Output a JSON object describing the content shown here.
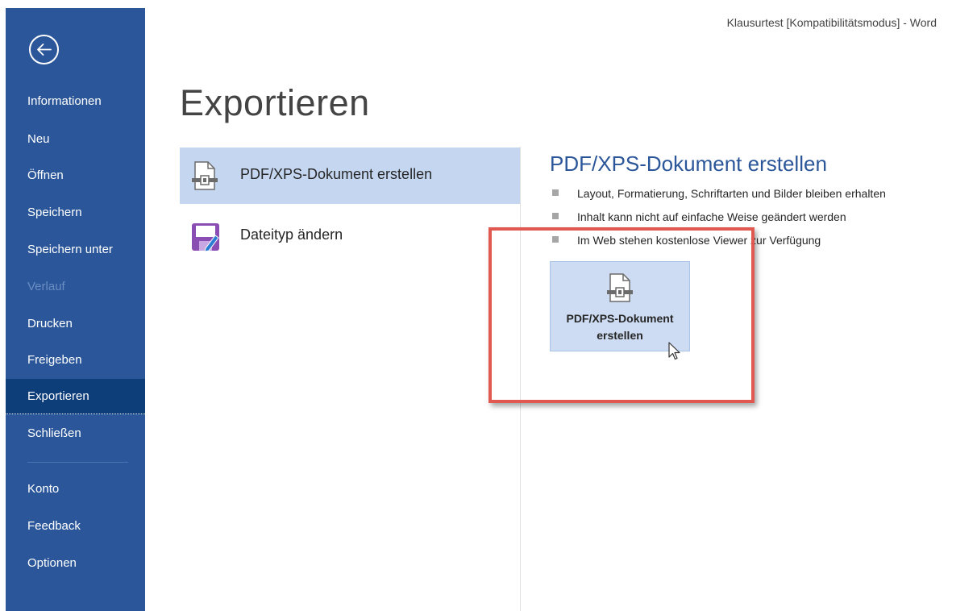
{
  "window": {
    "title": "Klausurtest [Kompatibilitätsmodus]  -  Word"
  },
  "sidebar": {
    "back_icon": "back-arrow-icon",
    "items": [
      {
        "label": "Informationen",
        "enabled": true
      },
      {
        "label": "Neu",
        "enabled": true
      },
      {
        "label": "Öffnen",
        "enabled": true
      },
      {
        "label": "Speichern",
        "enabled": true
      },
      {
        "label": "Speichern unter",
        "enabled": true
      },
      {
        "label": "Verlauf",
        "enabled": false
      },
      {
        "label": "Drucken",
        "enabled": true
      },
      {
        "label": "Freigeben",
        "enabled": true
      },
      {
        "label": "Exportieren",
        "enabled": true,
        "active": true
      },
      {
        "label": "Schließen",
        "enabled": true
      },
      {
        "label": "Konto",
        "enabled": true
      },
      {
        "label": "Feedback",
        "enabled": true
      },
      {
        "label": "Optionen",
        "enabled": true
      }
    ]
  },
  "main": {
    "page_title": "Exportieren",
    "options": [
      {
        "label": "PDF/XPS-Dokument erstellen",
        "icon": "pdf-xps-document-icon",
        "selected": true
      },
      {
        "label": "Dateityp ändern",
        "icon": "save-as-filetype-icon",
        "selected": false
      }
    ],
    "detail": {
      "title": "PDF/XPS-Dokument erstellen",
      "bullets": [
        "Layout, Formatierung, Schriftarten und Bilder bleiben erhalten",
        "Inhalt kann nicht auf einfache Weise geändert werden",
        "Im Web stehen kostenlose Viewer zur Verfügung"
      ],
      "button": {
        "label_line1": "PDF/XPS-Dokument",
        "label_line2": "erstellen",
        "icon": "pdf-xps-document-icon"
      }
    }
  },
  "colors": {
    "sidebar_bg": "#2b579a",
    "sidebar_active": "#0e3e7a",
    "selection_bg": "#c5d6f1",
    "accent_title": "#2b579a",
    "highlight_border": "#e0584f"
  }
}
